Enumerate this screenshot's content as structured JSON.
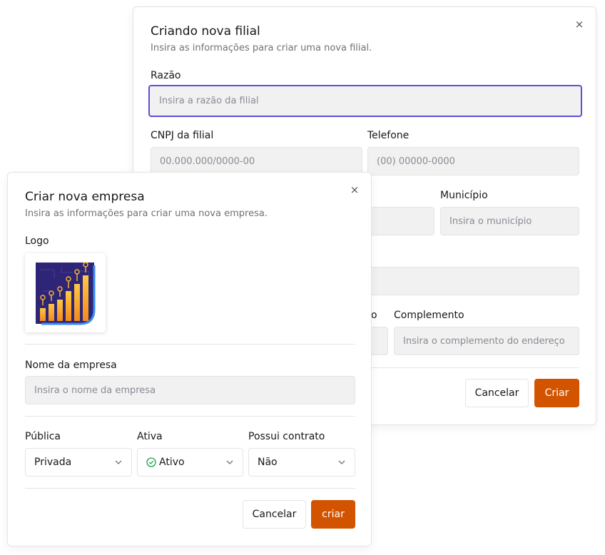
{
  "branch_dialog": {
    "title": "Criando nova filial",
    "subtitle": "Insira as informações para criar uma nova filial.",
    "close_glyph": "×",
    "fields": {
      "razao": {
        "label": "Razão",
        "placeholder": "Insira a razão da filial"
      },
      "cnpj": {
        "label": "CNPJ da filial",
        "placeholder": "00.000.000/0000-00"
      },
      "telefone": {
        "label": "Telefone",
        "placeholder": "(00) 00000-0000"
      },
      "municipio": {
        "label": "Município",
        "placeholder": "Insira o município"
      },
      "numero_fragment": {
        "label": "o"
      },
      "complemento": {
        "label": "Complemento",
        "placeholder": "Insira o complemento do endereço"
      }
    },
    "buttons": {
      "cancel": "Cancelar",
      "submit": "Criar"
    }
  },
  "company_dialog": {
    "title": "Criar nova empresa",
    "subtitle": "Insira as informações para criar uma nova empresa.",
    "close_glyph": "×",
    "logo": {
      "label": "Logo"
    },
    "nome": {
      "label": "Nome da empresa",
      "placeholder": "Insira o nome da empresa"
    },
    "publica": {
      "label": "Pública",
      "value": "Privada"
    },
    "ativa": {
      "label": "Ativa",
      "value": "Ativo"
    },
    "contrato": {
      "label": "Possui contrato",
      "value": "Não"
    },
    "buttons": {
      "cancel": "Cancelar",
      "submit": "criar"
    }
  },
  "icons": {
    "close": "close-icon",
    "chevron": "chevron-down-icon",
    "check": "check-circle-icon",
    "logo": "growth-chart-logo"
  },
  "colors": {
    "primary": "#d35400",
    "focus_ring": "#5b4fd6",
    "active_green": "#16a34a",
    "logo_bg": "#2e2577",
    "logo_accent": "#f5a623"
  }
}
